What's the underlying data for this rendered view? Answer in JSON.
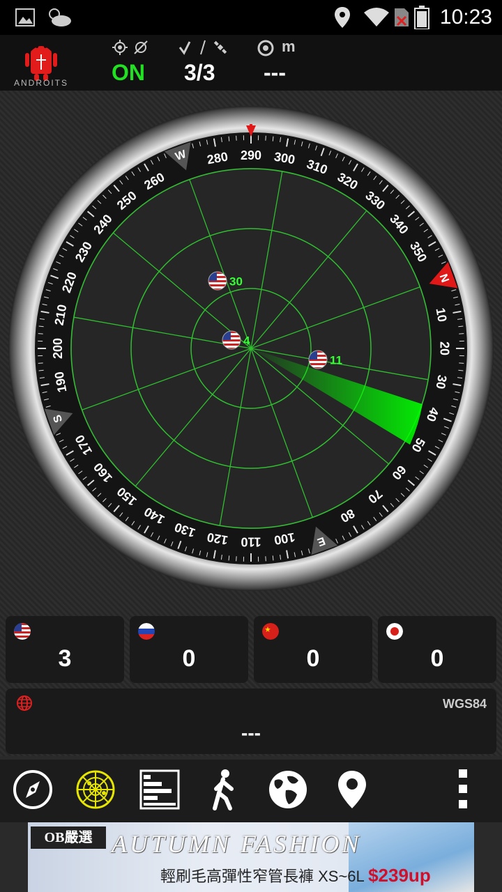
{
  "status_bar": {
    "time": "10:23"
  },
  "header": {
    "logo_text": "ANDROITS",
    "gps_state": "ON",
    "satellites_used": "3/3",
    "accuracy_value": "---",
    "accuracy_unit": "m"
  },
  "radar": {
    "compass_degrees": [
      "280",
      "290",
      "300",
      "310",
      "320",
      "330",
      "340",
      "350",
      "10",
      "20",
      "30",
      "40",
      "50",
      "60",
      "70",
      "80",
      "100",
      "110",
      "120",
      "130",
      "140",
      "150",
      "160",
      "170",
      "190",
      "200",
      "210",
      "220",
      "230",
      "240",
      "250",
      "260"
    ],
    "cardinals": {
      "n": "N",
      "e": "E",
      "s": "S",
      "w": "W"
    },
    "satellites": [
      {
        "id": "30",
        "constellation": "usa"
      },
      {
        "id": "4",
        "constellation": "usa"
      },
      {
        "id": "11",
        "constellation": "usa"
      }
    ],
    "colors": {
      "grid": "#2fbf2f",
      "sweep": "#00ff00",
      "label": "#33ff33"
    }
  },
  "constellations": [
    {
      "name": "usa",
      "count": "3"
    },
    {
      "name": "russia",
      "count": "0"
    },
    {
      "name": "china",
      "count": "0"
    },
    {
      "name": "japan",
      "count": "0"
    }
  ],
  "position": {
    "datum": "WGS84",
    "coordinates": "---"
  },
  "toolbar": {
    "items": [
      "compass-icon",
      "radar-icon",
      "signal-bars-icon",
      "walking-icon",
      "globe-icon",
      "map-pin-icon",
      "more-menu-icon"
    ]
  },
  "ad": {
    "brand": "OB嚴選",
    "title": "AUTUMN FASHION",
    "subtitle": "輕刷毛高彈性窄管長褲 XS~6L",
    "price": "$239up"
  }
}
